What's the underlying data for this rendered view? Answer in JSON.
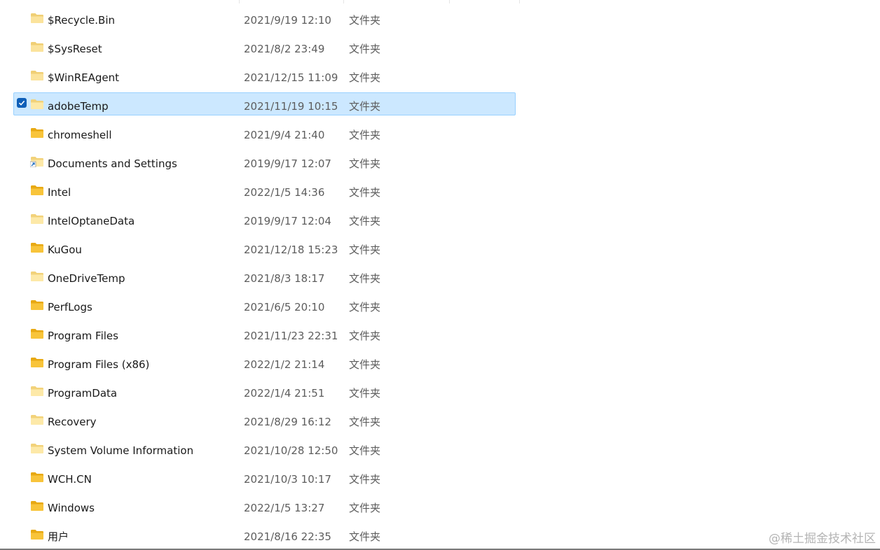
{
  "files": [
    {
      "name": "$Recycle.Bin",
      "date": "2021/9/19 12:10",
      "type": "文件夹",
      "icon": "folder-system-icon"
    },
    {
      "name": "$SysReset",
      "date": "2021/8/2 23:49",
      "type": "文件夹",
      "icon": "folder-system-icon"
    },
    {
      "name": "$WinREAgent",
      "date": "2021/12/15 11:09",
      "type": "文件夹",
      "icon": "folder-system-icon"
    },
    {
      "name": "adobeTemp",
      "date": "2021/11/19 10:15",
      "type": "文件夹",
      "icon": "folder-light-icon",
      "selected": true
    },
    {
      "name": "chromeshell",
      "date": "2021/9/4 21:40",
      "type": "文件夹",
      "icon": "folder-icon"
    },
    {
      "name": "Documents and Settings",
      "date": "2019/9/17 12:07",
      "type": "文件夹",
      "icon": "folder-shortcut-icon"
    },
    {
      "name": "Intel",
      "date": "2022/1/5 14:36",
      "type": "文件夹",
      "icon": "folder-icon"
    },
    {
      "name": "IntelOptaneData",
      "date": "2019/9/17 12:04",
      "type": "文件夹",
      "icon": "folder-light-icon"
    },
    {
      "name": "KuGou",
      "date": "2021/12/18 15:23",
      "type": "文件夹",
      "icon": "folder-icon"
    },
    {
      "name": "OneDriveTemp",
      "date": "2021/8/3 18:17",
      "type": "文件夹",
      "icon": "folder-light-icon"
    },
    {
      "name": "PerfLogs",
      "date": "2021/6/5 20:10",
      "type": "文件夹",
      "icon": "folder-icon"
    },
    {
      "name": "Program Files",
      "date": "2021/11/23 22:31",
      "type": "文件夹",
      "icon": "folder-icon"
    },
    {
      "name": "Program Files (x86)",
      "date": "2022/1/2 21:14",
      "type": "文件夹",
      "icon": "folder-icon"
    },
    {
      "name": "ProgramData",
      "date": "2022/1/4 21:51",
      "type": "文件夹",
      "icon": "folder-light-icon"
    },
    {
      "name": "Recovery",
      "date": "2021/8/29 16:12",
      "type": "文件夹",
      "icon": "folder-light-icon"
    },
    {
      "name": "System Volume Information",
      "date": "2021/10/28 12:50",
      "type": "文件夹",
      "icon": "folder-light-icon"
    },
    {
      "name": "WCH.CN",
      "date": "2021/10/3 10:17",
      "type": "文件夹",
      "icon": "folder-icon"
    },
    {
      "name": "Windows",
      "date": "2022/1/5 13:27",
      "type": "文件夹",
      "icon": "folder-icon"
    },
    {
      "name": "用户",
      "date": "2021/8/16 22:35",
      "type": "文件夹",
      "icon": "folder-icon"
    }
  ],
  "watermark": "@稀土掘金技术社区",
  "colors": {
    "selection_bg": "#cce8ff",
    "selection_border": "#99d1ff",
    "checkbox": "#0f5fb8",
    "folder_yellow": "#f8c43a",
    "folder_light": "#fde9a8",
    "text_primary": "#1a1a1a",
    "text_secondary": "#5d5d5d"
  }
}
